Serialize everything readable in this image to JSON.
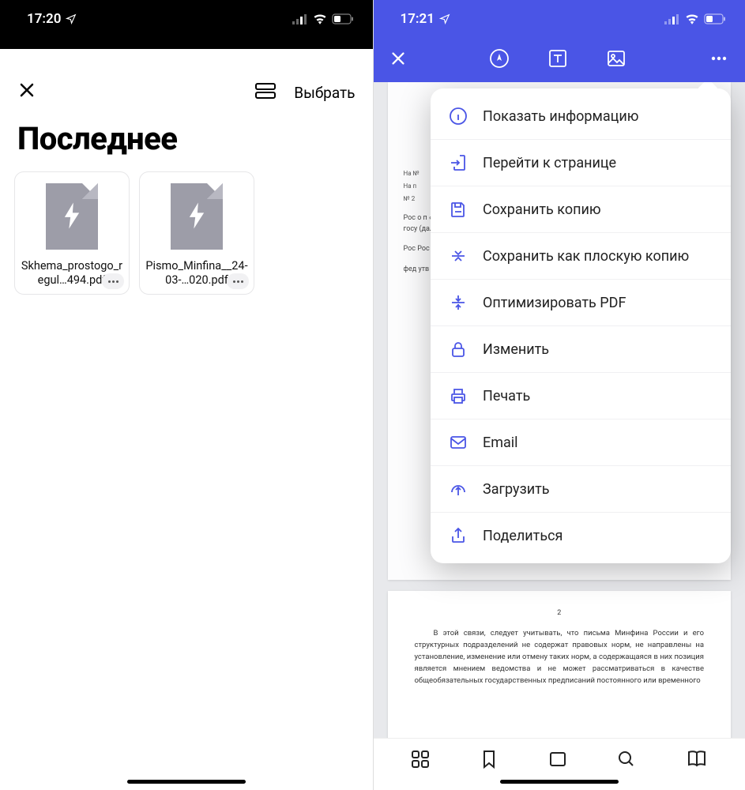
{
  "left": {
    "status_time": "17:20",
    "title": "Последнее",
    "select_label": "Выбрать",
    "files": [
      {
        "name": "Skhema_prostogo_regul…494.pdf"
      },
      {
        "name": "Pismo_Minfina__24-03-…020.pdf"
      }
    ]
  },
  "right": {
    "status_time": "17:21",
    "menu": [
      {
        "icon": "info-icon",
        "label": "Показать информацию"
      },
      {
        "icon": "goto-icon",
        "label": "Перейти к странице"
      },
      {
        "icon": "save-icon",
        "label": "Сохранить копию"
      },
      {
        "icon": "flatten-icon",
        "label": "Сохранить как плоскую копию"
      },
      {
        "icon": "optimize-icon",
        "label": "Оптимизировать PDF"
      },
      {
        "icon": "lock-icon",
        "label": "Изменить"
      },
      {
        "icon": "print-icon",
        "label": "Печать"
      },
      {
        "icon": "email-icon",
        "label": "Email"
      },
      {
        "icon": "upload-icon",
        "label": "Загрузить"
      },
      {
        "icon": "share-icon",
        "label": "Поделиться"
      }
    ],
    "doc": {
      "page1_lines": [
        "На №",
        "На п",
        "№ 2"
      ],
      "page1_blocks": [
        "Рос о п «О (дал Рос тов рос госу (дал",
        "Рос Рос не с его в есл обо",
        "фед утв от вла"
      ],
      "page2_num": "2",
      "page2_text": "В этой связи, следует учитывать, что письма Минфина России и его структурных подразделений не содержат правовых норм, не направлены на установление, изменение или отмену таких норм, а содержащаяся в них позиция является мнением ведомства и не может рассматриваться в качестве общеобязательных государственных предписаний постоянного или временного"
    }
  }
}
